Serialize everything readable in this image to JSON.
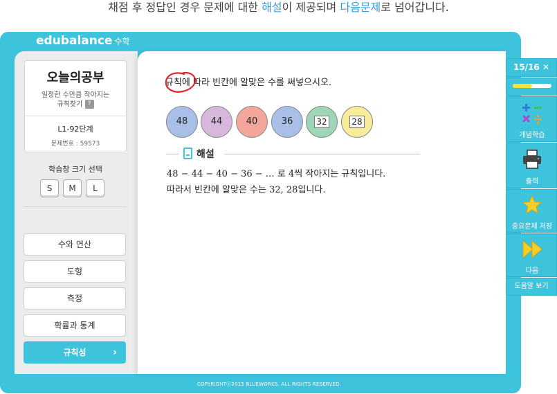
{
  "caption": {
    "part1": "채점 후 정답인 경우 문제에 대한 ",
    "highlight1": "해설",
    "part2": "이 제공되며 ",
    "highlight2": "다음문제",
    "part3": "로 넘어갑니다."
  },
  "brand": {
    "name": "edubalance",
    "subject": "수학"
  },
  "today_card": {
    "title": "오늘의공부",
    "subtitle_line1": "일정한 수만큼 작아지는",
    "subtitle_line2": "규칙찾기",
    "help_icon": "?",
    "level": "L1-92단계",
    "problem_no": "문제번호 : 59573"
  },
  "size_selector": {
    "label": "학습창 크기 선택",
    "options": [
      "S",
      "M",
      "L"
    ]
  },
  "nav": {
    "items": [
      {
        "label": "수와 연산"
      },
      {
        "label": "도형"
      },
      {
        "label": "측정"
      },
      {
        "label": "확률과 통계"
      },
      {
        "label": "규칙성",
        "active": true
      }
    ],
    "chevron": "›"
  },
  "question": {
    "text": "규칙에 따라 빈칸에 알맞은 수를 써넣으시오."
  },
  "sequence": [
    {
      "value": "48",
      "color": "#a9bfe8",
      "boxed": false
    },
    {
      "value": "44",
      "color": "#d7b8dc",
      "boxed": false
    },
    {
      "value": "40",
      "color": "#f3a79a",
      "boxed": false
    },
    {
      "value": "36",
      "color": "#a9bfe8",
      "boxed": false
    },
    {
      "value": "32",
      "color": "#9fd6b8",
      "boxed": true
    },
    {
      "value": "28",
      "color": "#f8ec9a",
      "boxed": true
    }
  ],
  "explanation": {
    "title": "해설",
    "line1": "48 − 44 − 40 − 36 − … 로 4씩 작아지는 규칙입니다.",
    "line2": "따라서 빈칸에 알맞은 수는 32, 28입니다."
  },
  "footer": {
    "copyright": "COPYRIGHTⓒ2015 BLUEWORKS. ALL RIGHTS RESERVED."
  },
  "right_panel": {
    "counter": "15/16",
    "close_icon": "✕",
    "progress": 0.5,
    "concept_label": "개념학습",
    "print_label": "출력",
    "save_label": "중요문제 저장",
    "next_label": "다음",
    "help_label": "도움말 보기"
  },
  "colors": {
    "accent": "#3ec3dd",
    "highlight_text": "#2f9fe0",
    "red_mark": "#e0262a",
    "progress_fill": "#f5e23a"
  }
}
